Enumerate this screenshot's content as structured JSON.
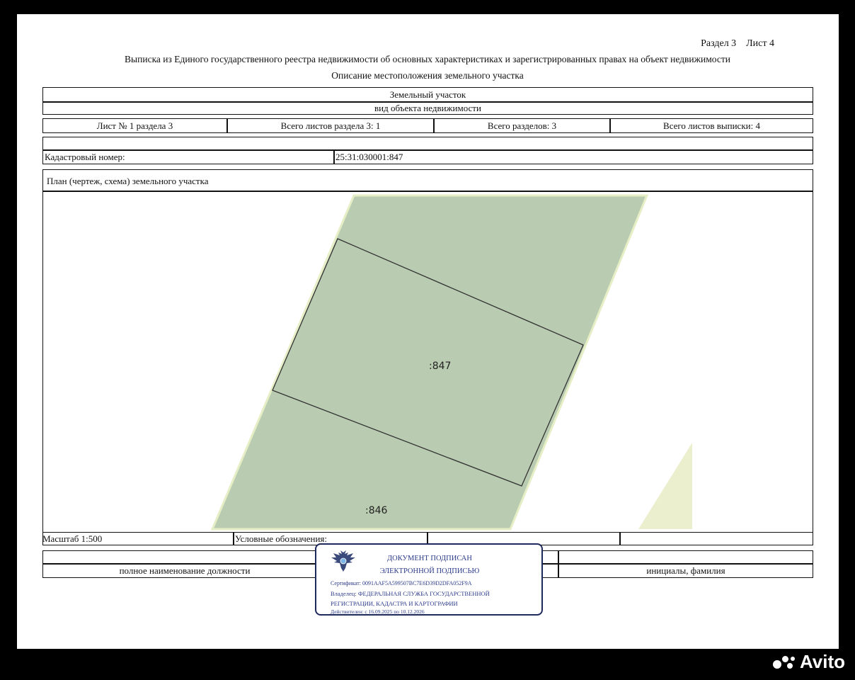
{
  "header": {
    "section_sheet": "Раздел 3    Лист 4",
    "title": "Выписка из Единого государственного реестра недвижимости об основных характеристиках и зарегистрированных правах на объект недвижимости",
    "subtitle": "Описание местоположения земельного участка"
  },
  "object": {
    "type": "Земельный участок",
    "type_caption": "вид объекта недвижимости"
  },
  "sheets": {
    "sheet": "Лист № 1 раздела 3",
    "total_section": "Всего листов раздела 3: 1",
    "total_sections": "Всего разделов: 3",
    "total_extract": "Всего листов выписки: 4"
  },
  "cadastral": {
    "label": "Кадастровый номер:",
    "value": "25:31:030001:847"
  },
  "plan": {
    "caption": "План (чертеж, схема) земельного участка",
    "parcel_main": ":847",
    "parcel_neighbor": ":846",
    "colors": {
      "parcel_fill": "#b9cbb0",
      "parcel_edge": "#e6eec6",
      "other_fill": "#ecefce",
      "outline": "#333333"
    }
  },
  "legend": {
    "scale": "Масштаб 1:500",
    "symbols": "Условные обозначения:"
  },
  "signature_row": {
    "position": "полное наименование должности",
    "name": "инициалы, фамилия"
  },
  "stamp": {
    "line1": "ДОКУМЕНТ ПОДПИСАН",
    "line2": "ЭЛЕКТРОННОЙ ПОДПИСЬЮ",
    "certificate": "Сертификат: 0091AAF5A599507BC7E6D39D2DFA052F9A",
    "owner_line1": "Владелец: ФЕДЕРАЛЬНАЯ СЛУЖБА ГОСУДАРСТВЕННОЙ",
    "owner_line2": "РЕГИСТРАЦИИ, КАДАСТРА И КАРТОГРАФИИ",
    "validity": "Действителен: с 16.09.2025 по 10.12.2026",
    "border_color": "#1f2a5c",
    "text_color": "#2b3a8a"
  },
  "watermark": {
    "text": "Avito",
    "icon": "avito-dots-icon"
  }
}
